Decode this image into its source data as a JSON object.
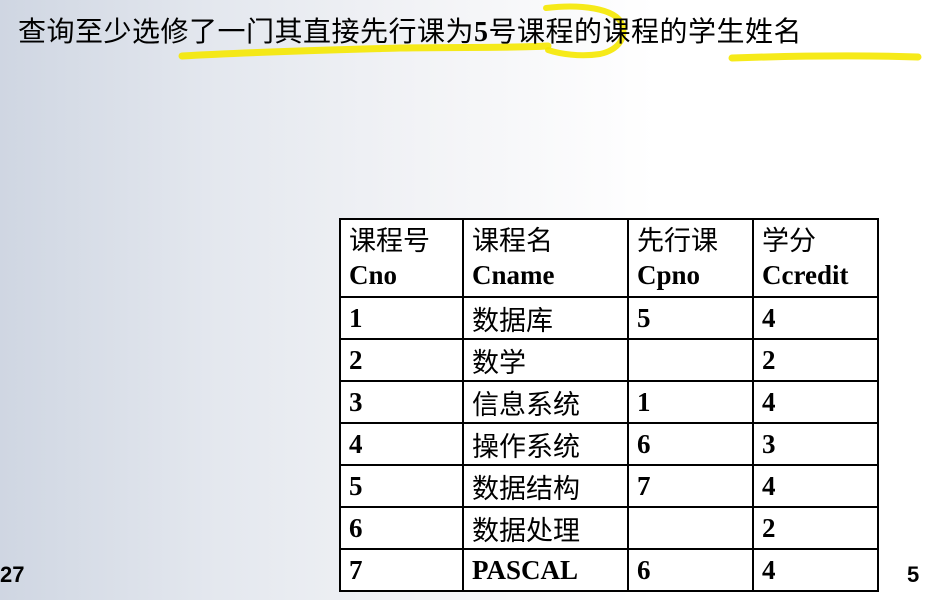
{
  "slide": {
    "title_part1": "查询至少选修了一门其直接先行课为",
    "title_num": "5",
    "title_part2": "号课程的课程的学生姓名",
    "page_left": "27",
    "page_right": "5",
    "highlight_color": "#f5e800"
  },
  "table": {
    "headers": [
      {
        "zh": "课程号",
        "en": "Cno"
      },
      {
        "zh": "课程名",
        "en": "Cname"
      },
      {
        "zh": "先行课",
        "en": "Cpno"
      },
      {
        "zh": "学分",
        "en": "Ccredit"
      }
    ],
    "rows": [
      [
        "1",
        "数据库",
        "5",
        "4"
      ],
      [
        "2",
        "数学",
        "",
        "2"
      ],
      [
        "3",
        "信息系统",
        "1",
        "4"
      ],
      [
        "4",
        "操作系统",
        "6",
        "3"
      ],
      [
        "5",
        "数据结构",
        "7",
        "4"
      ],
      [
        "6",
        "数据处理",
        "",
        "2"
      ],
      [
        "7",
        "PASCAL",
        "6",
        "4"
      ]
    ]
  }
}
